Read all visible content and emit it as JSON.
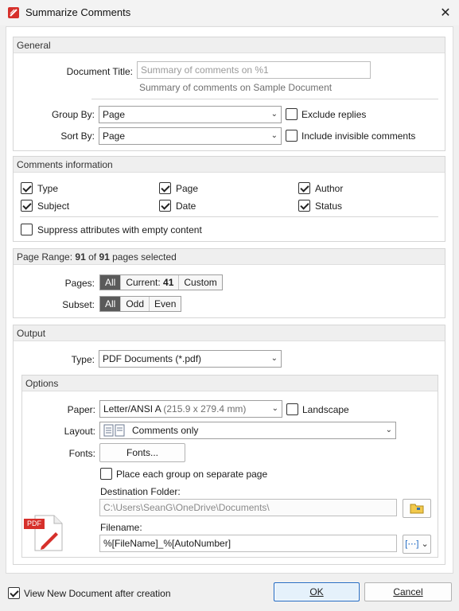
{
  "window": {
    "title": "Summarize Comments"
  },
  "general": {
    "header": "General",
    "doc_title_label": "Document Title:",
    "doc_title_placeholder": "Summary of comments on %1",
    "doc_title_preview": "Summary of comments on Sample Document",
    "group_by_label": "Group By:",
    "group_by_value": "Page",
    "sort_by_label": "Sort By:",
    "sort_by_value": "Page",
    "exclude_replies": {
      "label": "Exclude replies",
      "checked": false
    },
    "include_invisible": {
      "label": "Include invisible comments",
      "checked": false
    }
  },
  "comments_info": {
    "header": "Comments information",
    "items": [
      {
        "label": "Type",
        "checked": true
      },
      {
        "label": "Page",
        "checked": true
      },
      {
        "label": "Author",
        "checked": true
      },
      {
        "label": "Subject",
        "checked": true
      },
      {
        "label": "Date",
        "checked": true
      },
      {
        "label": "Status",
        "checked": true
      }
    ],
    "suppress": {
      "label": "Suppress attributes with empty content",
      "checked": false
    }
  },
  "page_range": {
    "header_prefix": "Page Range: ",
    "selected": "91",
    "of": " of ",
    "total": "91",
    "suffix": " pages selected",
    "pages_label": "Pages:",
    "pages_all": "All",
    "pages_current": "Current: ",
    "pages_current_num": "41",
    "pages_custom": "Custom",
    "subset_label": "Subset:",
    "subset_all": "All",
    "subset_odd": "Odd",
    "subset_even": "Even"
  },
  "output": {
    "header": "Output",
    "type_label": "Type:",
    "type_value": "PDF Documents (*.pdf)"
  },
  "options": {
    "header": "Options",
    "paper_label": "Paper:",
    "paper_value": "Letter/ANSI A",
    "paper_dims": " (215.9 x 279.4 mm)",
    "landscape": {
      "label": "Landscape",
      "checked": false
    },
    "layout_label": "Layout:",
    "layout_value": "Comments only",
    "fonts_label": "Fonts:",
    "fonts_button": "Fonts...",
    "separate_page": {
      "label": "Place each group on separate page",
      "checked": false
    },
    "dest_folder_label": "Destination Folder:",
    "dest_folder_value": "C:\\Users\\SeanG\\OneDrive\\Documents\\",
    "filename_label": "Filename:",
    "filename_value": "%[FileName]_%[AutoNumber]",
    "pdf_badge": "PDF"
  },
  "footer": {
    "view_new_doc": {
      "label": "View New Document after creation",
      "checked": true
    },
    "ok": "OK",
    "cancel": "Cancel"
  }
}
